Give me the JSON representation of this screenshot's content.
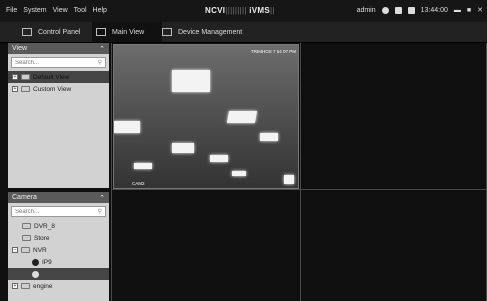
{
  "menu": [
    "File",
    "System",
    "View",
    "Tool",
    "Help"
  ],
  "app_title": {
    "left": "NCVI",
    "mid": "|||||||||",
    "right": "iVMS",
    "suffix": "||"
  },
  "tray": {
    "user": "admin",
    "time": "13:44:00"
  },
  "tabs": [
    {
      "label": "Control Panel",
      "icon": "grid-icon"
    },
    {
      "label": "Main View",
      "icon": "monitor-icon"
    },
    {
      "label": "Device Management",
      "icon": "camera-device-icon"
    }
  ],
  "view_panel": {
    "title": "View",
    "search_placeholder": "Search...",
    "items": [
      "Default View",
      "Custom View"
    ]
  },
  "camera_panel": {
    "title": "Camera",
    "search_placeholder": "Search...",
    "items": [
      "DVR_8",
      "Store",
      "NVR",
      "IP9",
      "engine"
    ]
  },
  "feed": {
    "osd_top": "TRIMHOS 7 54 07 PM",
    "osd_bottom": "CAM2"
  },
  "colors": {
    "selected": "#454545",
    "panel": "#d2d2d2",
    "background": "#0f0f0f"
  }
}
